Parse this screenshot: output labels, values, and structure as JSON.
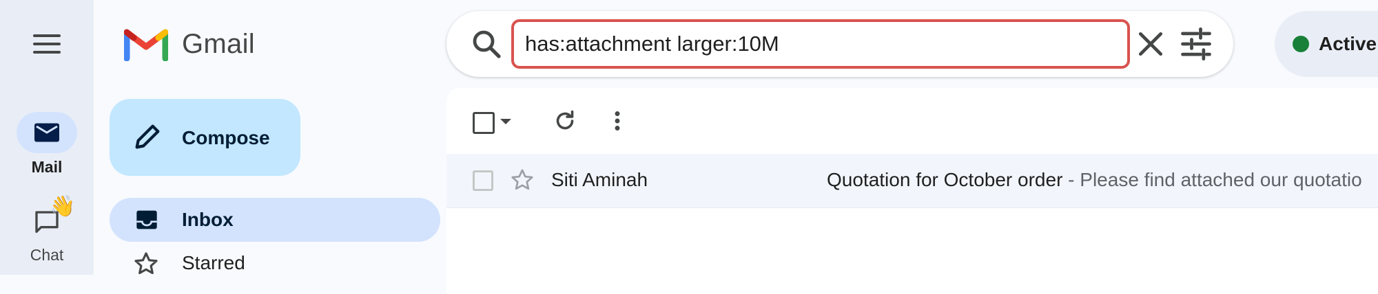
{
  "app": {
    "name": "Gmail"
  },
  "rail": {
    "menu_icon": "hamburger-menu-icon",
    "items": [
      {
        "label": "Mail",
        "icon": "mail-icon",
        "active": true
      },
      {
        "label": "Chat",
        "icon": "chat-bubble-icon",
        "badge_emoji": "👋"
      }
    ]
  },
  "compose": {
    "label": "Compose",
    "icon": "pencil-icon"
  },
  "nav": {
    "items": [
      {
        "label": "Inbox",
        "icon": "inbox-icon",
        "active": true
      },
      {
        "label": "Starred",
        "icon": "star-outline-icon"
      }
    ]
  },
  "search": {
    "value": "has:attachment larger:10M",
    "search_icon": "search-icon",
    "clear_icon": "close-icon",
    "filter_icon": "tune-filter-icon"
  },
  "status": {
    "label": "Active",
    "color": "#188038"
  },
  "toolbar": {
    "select_icon": "checkbox-icon",
    "select_caret_icon": "caret-down-icon",
    "refresh_icon": "refresh-icon",
    "more_icon": "more-vert-icon"
  },
  "emails": [
    {
      "sender": "Siti Aminah",
      "subject": "Quotation for October order",
      "snippet": " - Please find attached our quotatio"
    }
  ],
  "colors": {
    "accent": "#c2e7ff",
    "nav_active": "#d3e3fd",
    "search_highlight": "#d9534f"
  }
}
